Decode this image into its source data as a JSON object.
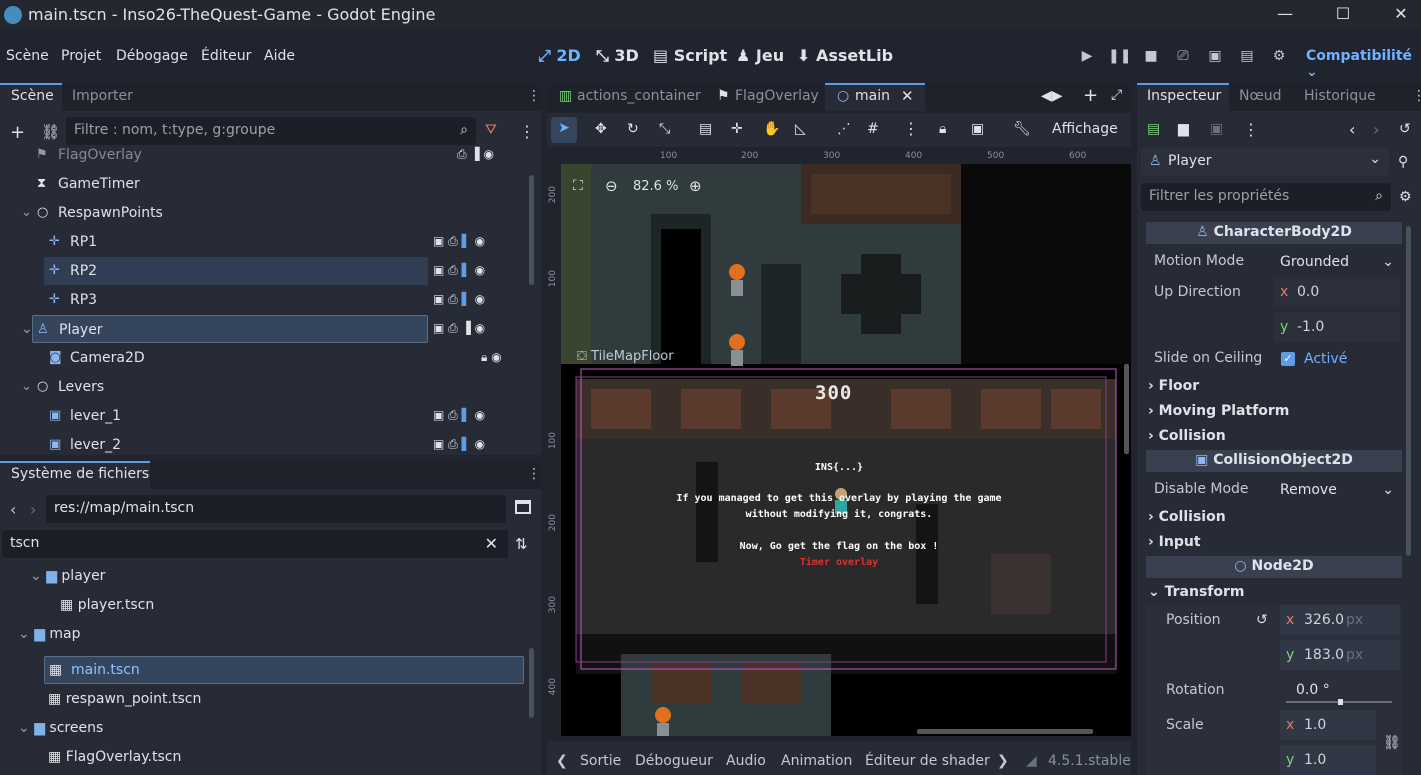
{
  "window": {
    "title": "main.tscn - Inso26-TheQuest-Game - Godot Engine",
    "minimize": "—",
    "maximize": "☐",
    "close": "✕"
  },
  "menu": [
    "Scène",
    "Projet",
    "Débogage",
    "Éditeur",
    "Aide"
  ],
  "workspaces": [
    {
      "icon": "⤢",
      "label": "2D",
      "active": true
    },
    {
      "icon": "⤡",
      "label": "3D"
    },
    {
      "icon": "▤",
      "label": "Script"
    },
    {
      "icon": "♟",
      "label": "Jeu"
    },
    {
      "icon": "⬇",
      "label": "AssetLib"
    }
  ],
  "renderer": "Compatibilité",
  "scene_dock": {
    "tabs": [
      "Scène",
      "Importer"
    ],
    "filter_placeholder": "Filtre : nom, t:type, g:groupe",
    "nodes": [
      {
        "label": "FlagOverlay",
        "icon": "flag-icon",
        "glyph": "⚑",
        "indent": 1,
        "dim": true
      },
      {
        "label": "GameTimer",
        "icon": "timer-icon",
        "glyph": "⧗",
        "indent": 1
      },
      {
        "label": "RespawnPoints",
        "icon": "node2d-icon",
        "glyph": "○",
        "indent": 1,
        "expanded": true
      },
      {
        "label": "RP1",
        "icon": "marker2d-icon",
        "glyph": "✛",
        "indent": 2
      },
      {
        "label": "RP2",
        "icon": "marker2d-icon",
        "glyph": "✛",
        "indent": 2,
        "selected": "soft"
      },
      {
        "label": "RP3",
        "icon": "marker2d-icon",
        "glyph": "✛",
        "indent": 2
      },
      {
        "label": "Player",
        "icon": "characterbody2d-icon",
        "glyph": "♙",
        "indent": 1,
        "selected": "strong",
        "expanded": true
      },
      {
        "label": "Camera2D",
        "icon": "camera2d-icon",
        "glyph": "◙",
        "indent": 2
      },
      {
        "label": "Levers",
        "icon": "node2d-icon",
        "glyph": "○",
        "indent": 1,
        "expanded": true
      },
      {
        "label": "lever_1",
        "icon": "area2d-icon",
        "glyph": "▣",
        "indent": 2
      },
      {
        "label": "lever_2",
        "icon": "area2d-icon",
        "glyph": "▣",
        "indent": 2
      }
    ]
  },
  "filesystem": {
    "tab": "Système de fichiers",
    "path": "res://map/main.tscn",
    "search_value": "tscn",
    "items": [
      {
        "label": "player",
        "type": "folder",
        "indent": 1
      },
      {
        "label": "player.tscn",
        "type": "scene",
        "indent": 2
      },
      {
        "label": "map",
        "type": "folder",
        "indent": 0
      },
      {
        "label": "main.tscn",
        "type": "scene",
        "indent": 1,
        "selected": true
      },
      {
        "label": "respawn_point.tscn",
        "type": "scene",
        "indent": 1
      },
      {
        "label": "screens",
        "type": "folder",
        "indent": 0
      },
      {
        "label": "FlagOverlay.tscn",
        "type": "scene",
        "indent": 1
      }
    ]
  },
  "editor_tabs": [
    {
      "label": "actions_container",
      "icon": "container-icon"
    },
    {
      "label": "FlagOverlay",
      "icon": "flag-icon"
    },
    {
      "label": "main",
      "icon": "node2d-icon",
      "active": true
    }
  ],
  "toolbar": {
    "view_menu": "Affichage"
  },
  "viewport": {
    "zoom": "82.6 %",
    "ruler_top": [
      "100",
      "200",
      "300",
      "400",
      "500",
      "600"
    ],
    "ruler_left": [
      "200",
      "100",
      "100",
      "200",
      "300",
      "400"
    ],
    "tilemap_label": "TileMapFloor",
    "score": "300",
    "overlay_title": "INS{...}",
    "overlay_line1": "If you managed to get this overlay by playing the game",
    "overlay_line2": "without modifying it, congrats.",
    "overlay_line3": "Now, Go get the flag on the box !",
    "overlay_timer": "Timer overlay"
  },
  "bottom_tabs": [
    "Sortie",
    "Débogueur",
    "Audio",
    "Animation",
    "Éditeur de shader"
  ],
  "version": "4.5.1.stable",
  "inspector": {
    "tabs": [
      "Inspecteur",
      "Nœud",
      "Historique"
    ],
    "node_name": "Player",
    "filter_placeholder": "Filtrer les propriétés",
    "class_characterbody": "CharacterBody2D",
    "motion_mode_label": "Motion Mode",
    "motion_mode_value": "Grounded",
    "up_direction_label": "Up Direction",
    "up_x": "0.0",
    "up_y": "-1.0",
    "slide_label": "Slide on Ceiling",
    "slide_value": "Activé",
    "sec_floor": "Floor",
    "sec_moving": "Moving Platform",
    "sec_collision": "Collision",
    "class_collisionobject": "CollisionObject2D",
    "disable_mode_label": "Disable Mode",
    "disable_mode_value": "Remove",
    "sec_collision2": "Collision",
    "sec_input": "Input",
    "class_node2d": "Node2D",
    "sec_transform": "Transform",
    "position_label": "Position",
    "pos_x": "326.0",
    "pos_y": "183.0",
    "unit": "px",
    "rotation_label": "Rotation",
    "rotation_value": "0.0 °",
    "scale_label": "Scale",
    "scale_x": "1.0",
    "scale_y": "1.0"
  },
  "colors": {
    "accent": "#5e9de6",
    "active_text": "#6fb2ff",
    "bg": "#1f242e",
    "panel": "#262b35"
  }
}
